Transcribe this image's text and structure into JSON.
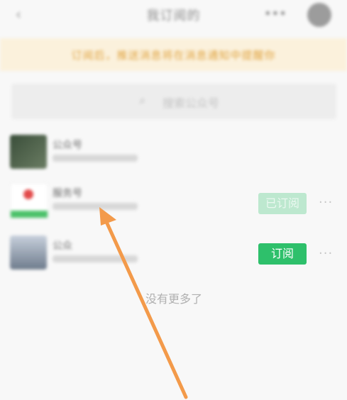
{
  "header": {
    "back_icon": "‹",
    "title": "我订阅的",
    "more_icon": "•••",
    "avatar": "avatar"
  },
  "banner": {
    "text": "订阅后，推送消息将在消息通知中提醒你"
  },
  "search": {
    "placeholder": "搜索公众号"
  },
  "list": [
    {
      "name": "公众号",
      "button": "",
      "has_button": false
    },
    {
      "name": "服务号",
      "button": "已订阅",
      "has_button": true,
      "state": "subscribed"
    },
    {
      "name": "公众",
      "button": "订阅",
      "has_button": true,
      "state": "not_subscribed"
    }
  ],
  "more_icon": "···",
  "footer": {
    "no_more_text": "没有更多了"
  },
  "colors": {
    "accent_green": "#2ec06b",
    "light_green": "#bde8cf",
    "banner_bg": "#fbf1dc",
    "banner_text": "#e0a33f",
    "annotation_arrow": "#f39a4a"
  }
}
